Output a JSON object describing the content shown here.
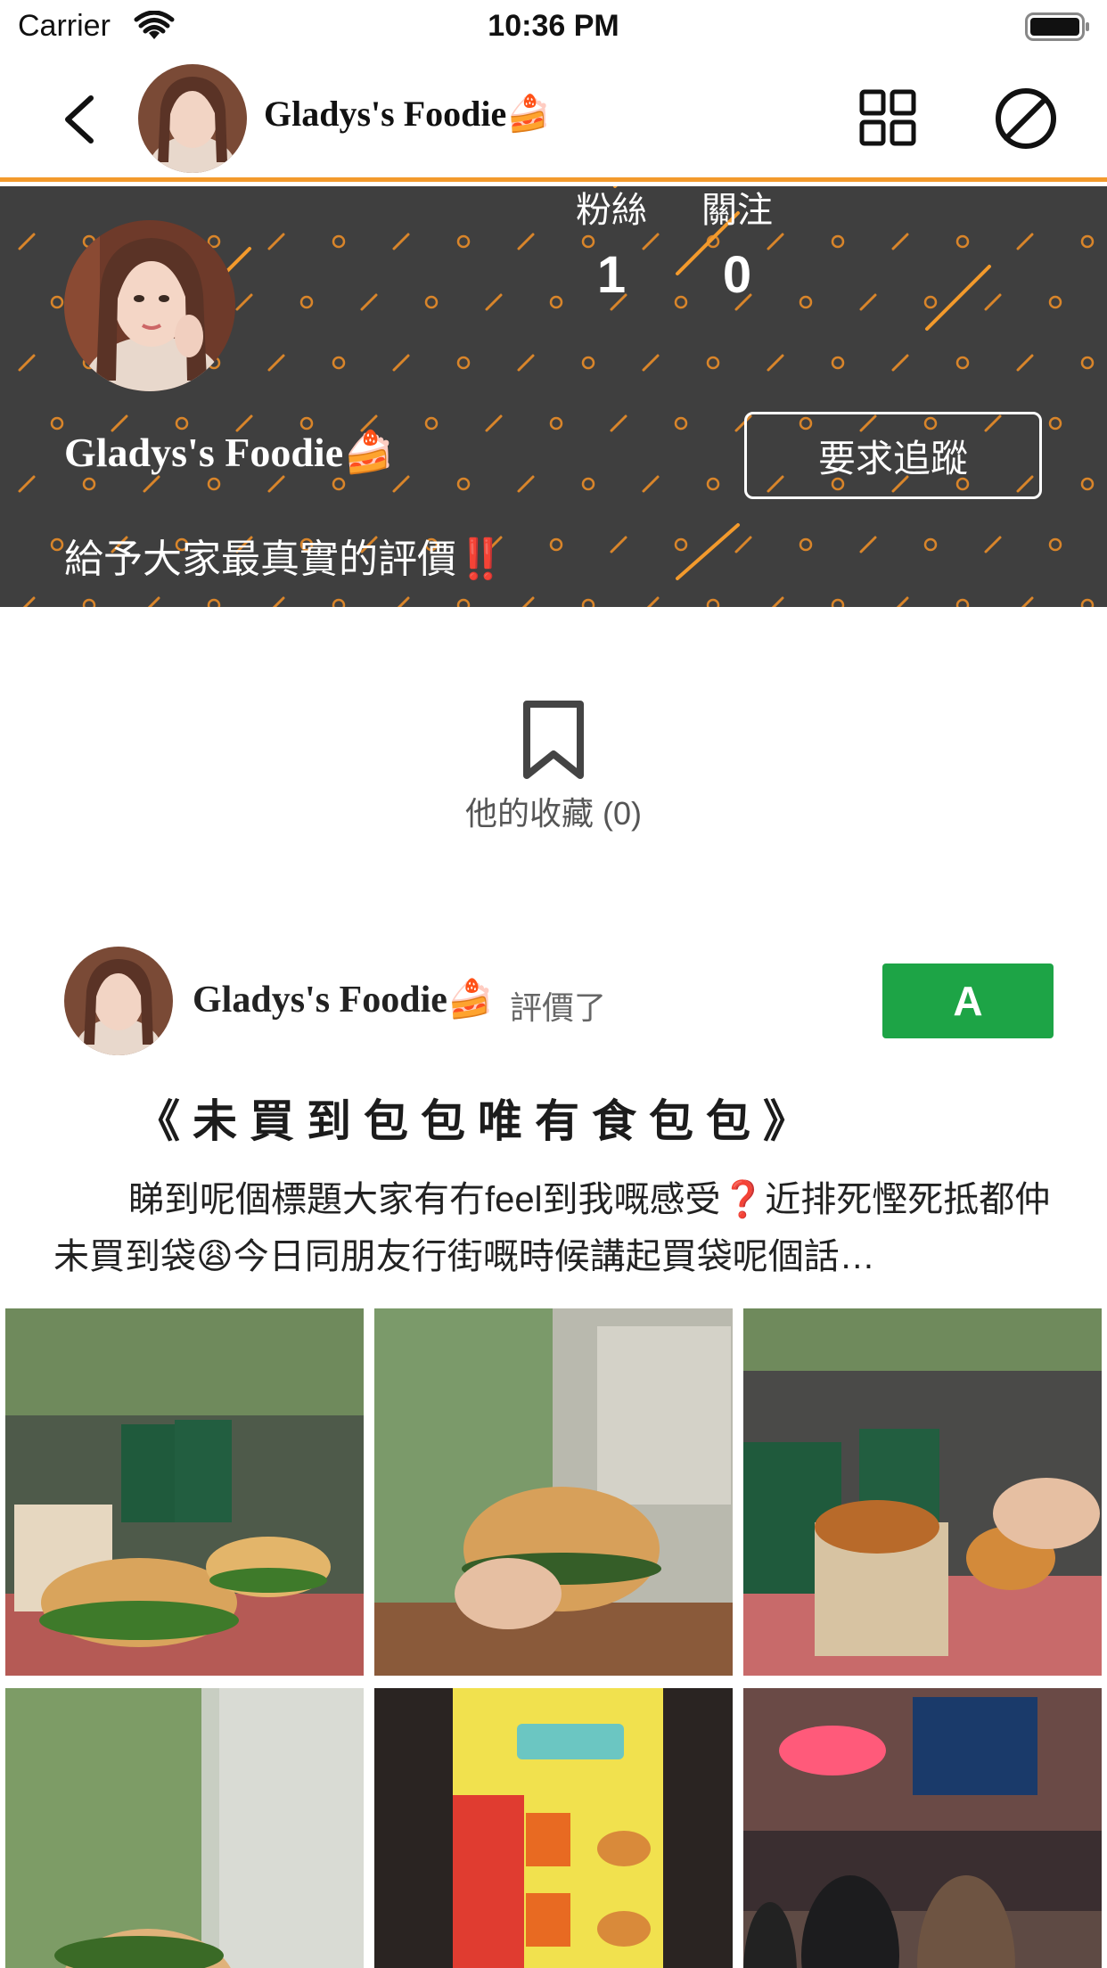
{
  "status_bar": {
    "carrier": "Carrier",
    "time": "10:36 PM"
  },
  "nav": {
    "title": "Gladys's Foodie🍰",
    "icons": [
      "chevron-left-icon",
      "grid-icon",
      "block-icon"
    ]
  },
  "profile": {
    "name": "Gladys's Foodie🍰",
    "bio": "給予大家最真實的評價‼️",
    "followers_label": "粉絲",
    "followers_count": "1",
    "following_label": "關注",
    "following_count": "0",
    "follow_button": "要求追蹤"
  },
  "collections": {
    "label": "他的收藏 (0)",
    "icon": "bookmark-icon"
  },
  "post": {
    "author": "Gladys's Foodie🍰",
    "action": "評價了",
    "grade": "A",
    "title": "《未買到包包唯有食包包》",
    "body": "睇到呢個標題大家有冇feel到我嘅感受❓近排死慳死抵都仲未買到袋😩今日同朋友行街嘅時候講起買袋呢個話…",
    "photos": [
      "burgers-and-drinks",
      "hand-holding-burger",
      "fried-snack-box",
      "burger-closeup",
      "snack-menu-board",
      "burga-store-counter"
    ]
  },
  "colors": {
    "accent": "#f39a2c",
    "header_bg": "#3f3f3f",
    "grade_green": "#1da446"
  }
}
